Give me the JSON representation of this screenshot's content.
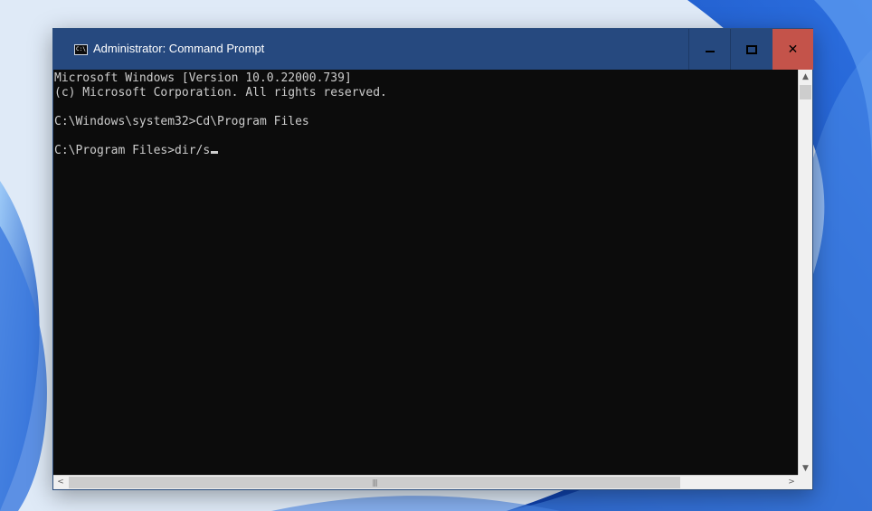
{
  "window": {
    "title": "Administrator: Command Prompt",
    "icon": "cmd-icon",
    "icon_text": "C:\\",
    "controls": {
      "minimize": "minimize-icon",
      "maximize": "maximize-icon",
      "close": "close-icon",
      "close_glyph": "✕",
      "close_color": "#c4534a"
    },
    "titlebar_color": "#26497f"
  },
  "console": {
    "lines": [
      "Microsoft Windows [Version 10.0.22000.739]",
      "(c) Microsoft Corporation. All rights reserved.",
      "",
      "C:\\Windows\\system32>Cd\\Program Files",
      "",
      "C:\\Program Files>dir/s"
    ],
    "background": "#0c0c0c",
    "foreground": "#cccccc"
  },
  "scrollbars": {
    "up_arrow": "▲",
    "down_arrow": "▼",
    "left_arrow": "<",
    "right_arrow": ">",
    "grip": "|||"
  }
}
